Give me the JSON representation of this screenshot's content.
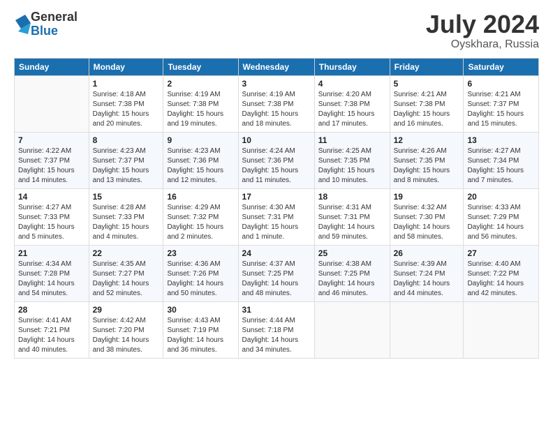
{
  "logo": {
    "general": "General",
    "blue": "Blue"
  },
  "title": "July 2024",
  "subtitle": "Oyskhara, Russia",
  "header_days": [
    "Sunday",
    "Monday",
    "Tuesday",
    "Wednesday",
    "Thursday",
    "Friday",
    "Saturday"
  ],
  "weeks": [
    [
      {
        "day": "",
        "info": ""
      },
      {
        "day": "1",
        "info": "Sunrise: 4:18 AM\nSunset: 7:38 PM\nDaylight: 15 hours\nand 20 minutes."
      },
      {
        "day": "2",
        "info": "Sunrise: 4:19 AM\nSunset: 7:38 PM\nDaylight: 15 hours\nand 19 minutes."
      },
      {
        "day": "3",
        "info": "Sunrise: 4:19 AM\nSunset: 7:38 PM\nDaylight: 15 hours\nand 18 minutes."
      },
      {
        "day": "4",
        "info": "Sunrise: 4:20 AM\nSunset: 7:38 PM\nDaylight: 15 hours\nand 17 minutes."
      },
      {
        "day": "5",
        "info": "Sunrise: 4:21 AM\nSunset: 7:38 PM\nDaylight: 15 hours\nand 16 minutes."
      },
      {
        "day": "6",
        "info": "Sunrise: 4:21 AM\nSunset: 7:37 PM\nDaylight: 15 hours\nand 15 minutes."
      }
    ],
    [
      {
        "day": "7",
        "info": "Sunrise: 4:22 AM\nSunset: 7:37 PM\nDaylight: 15 hours\nand 14 minutes."
      },
      {
        "day": "8",
        "info": "Sunrise: 4:23 AM\nSunset: 7:37 PM\nDaylight: 15 hours\nand 13 minutes."
      },
      {
        "day": "9",
        "info": "Sunrise: 4:23 AM\nSunset: 7:36 PM\nDaylight: 15 hours\nand 12 minutes."
      },
      {
        "day": "10",
        "info": "Sunrise: 4:24 AM\nSunset: 7:36 PM\nDaylight: 15 hours\nand 11 minutes."
      },
      {
        "day": "11",
        "info": "Sunrise: 4:25 AM\nSunset: 7:35 PM\nDaylight: 15 hours\nand 10 minutes."
      },
      {
        "day": "12",
        "info": "Sunrise: 4:26 AM\nSunset: 7:35 PM\nDaylight: 15 hours\nand 8 minutes."
      },
      {
        "day": "13",
        "info": "Sunrise: 4:27 AM\nSunset: 7:34 PM\nDaylight: 15 hours\nand 7 minutes."
      }
    ],
    [
      {
        "day": "14",
        "info": "Sunrise: 4:27 AM\nSunset: 7:33 PM\nDaylight: 15 hours\nand 5 minutes."
      },
      {
        "day": "15",
        "info": "Sunrise: 4:28 AM\nSunset: 7:33 PM\nDaylight: 15 hours\nand 4 minutes."
      },
      {
        "day": "16",
        "info": "Sunrise: 4:29 AM\nSunset: 7:32 PM\nDaylight: 15 hours\nand 2 minutes."
      },
      {
        "day": "17",
        "info": "Sunrise: 4:30 AM\nSunset: 7:31 PM\nDaylight: 15 hours\nand 1 minute."
      },
      {
        "day": "18",
        "info": "Sunrise: 4:31 AM\nSunset: 7:31 PM\nDaylight: 14 hours\nand 59 minutes."
      },
      {
        "day": "19",
        "info": "Sunrise: 4:32 AM\nSunset: 7:30 PM\nDaylight: 14 hours\nand 58 minutes."
      },
      {
        "day": "20",
        "info": "Sunrise: 4:33 AM\nSunset: 7:29 PM\nDaylight: 14 hours\nand 56 minutes."
      }
    ],
    [
      {
        "day": "21",
        "info": "Sunrise: 4:34 AM\nSunset: 7:28 PM\nDaylight: 14 hours\nand 54 minutes."
      },
      {
        "day": "22",
        "info": "Sunrise: 4:35 AM\nSunset: 7:27 PM\nDaylight: 14 hours\nand 52 minutes."
      },
      {
        "day": "23",
        "info": "Sunrise: 4:36 AM\nSunset: 7:26 PM\nDaylight: 14 hours\nand 50 minutes."
      },
      {
        "day": "24",
        "info": "Sunrise: 4:37 AM\nSunset: 7:25 PM\nDaylight: 14 hours\nand 48 minutes."
      },
      {
        "day": "25",
        "info": "Sunrise: 4:38 AM\nSunset: 7:25 PM\nDaylight: 14 hours\nand 46 minutes."
      },
      {
        "day": "26",
        "info": "Sunrise: 4:39 AM\nSunset: 7:24 PM\nDaylight: 14 hours\nand 44 minutes."
      },
      {
        "day": "27",
        "info": "Sunrise: 4:40 AM\nSunset: 7:22 PM\nDaylight: 14 hours\nand 42 minutes."
      }
    ],
    [
      {
        "day": "28",
        "info": "Sunrise: 4:41 AM\nSunset: 7:21 PM\nDaylight: 14 hours\nand 40 minutes."
      },
      {
        "day": "29",
        "info": "Sunrise: 4:42 AM\nSunset: 7:20 PM\nDaylight: 14 hours\nand 38 minutes."
      },
      {
        "day": "30",
        "info": "Sunrise: 4:43 AM\nSunset: 7:19 PM\nDaylight: 14 hours\nand 36 minutes."
      },
      {
        "day": "31",
        "info": "Sunrise: 4:44 AM\nSunset: 7:18 PM\nDaylight: 14 hours\nand 34 minutes."
      },
      {
        "day": "",
        "info": ""
      },
      {
        "day": "",
        "info": ""
      },
      {
        "day": "",
        "info": ""
      }
    ]
  ]
}
